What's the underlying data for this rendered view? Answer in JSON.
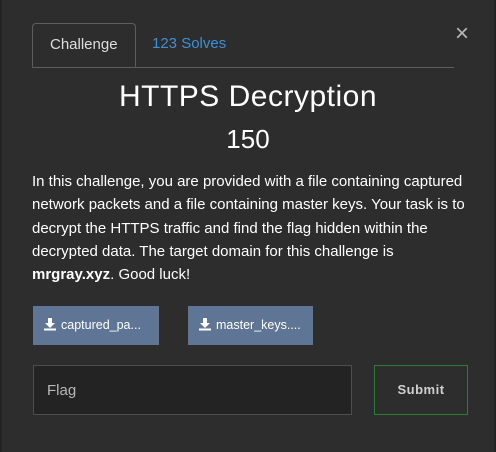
{
  "tabs": {
    "challenge_label": "Challenge",
    "solves_label": "123 Solves"
  },
  "close_glyph": "×",
  "challenge": {
    "title": "HTTPS Decryption",
    "points": "150",
    "description_before": "In this challenge, you are provided with a file containing captured network packets and a file containing master keys. Your task is to decrypt the HTTPS traffic and find the flag hidden within the decrypted data. The target domain for this challenge is ",
    "domain": "mrgray.xyz",
    "description_after": ". Good luck!"
  },
  "files": [
    {
      "label": "captured_pa...",
      "icon": "download-icon"
    },
    {
      "label": "master_keys....",
      "icon": "download-icon"
    }
  ],
  "flag_input": {
    "placeholder": "Flag",
    "value": ""
  },
  "submit_label": "Submit",
  "colors": {
    "accent_link": "#3e8fd6",
    "file_button": "#5f7596",
    "submit_border": "#2e7d32",
    "background": "#2d2d2d"
  }
}
